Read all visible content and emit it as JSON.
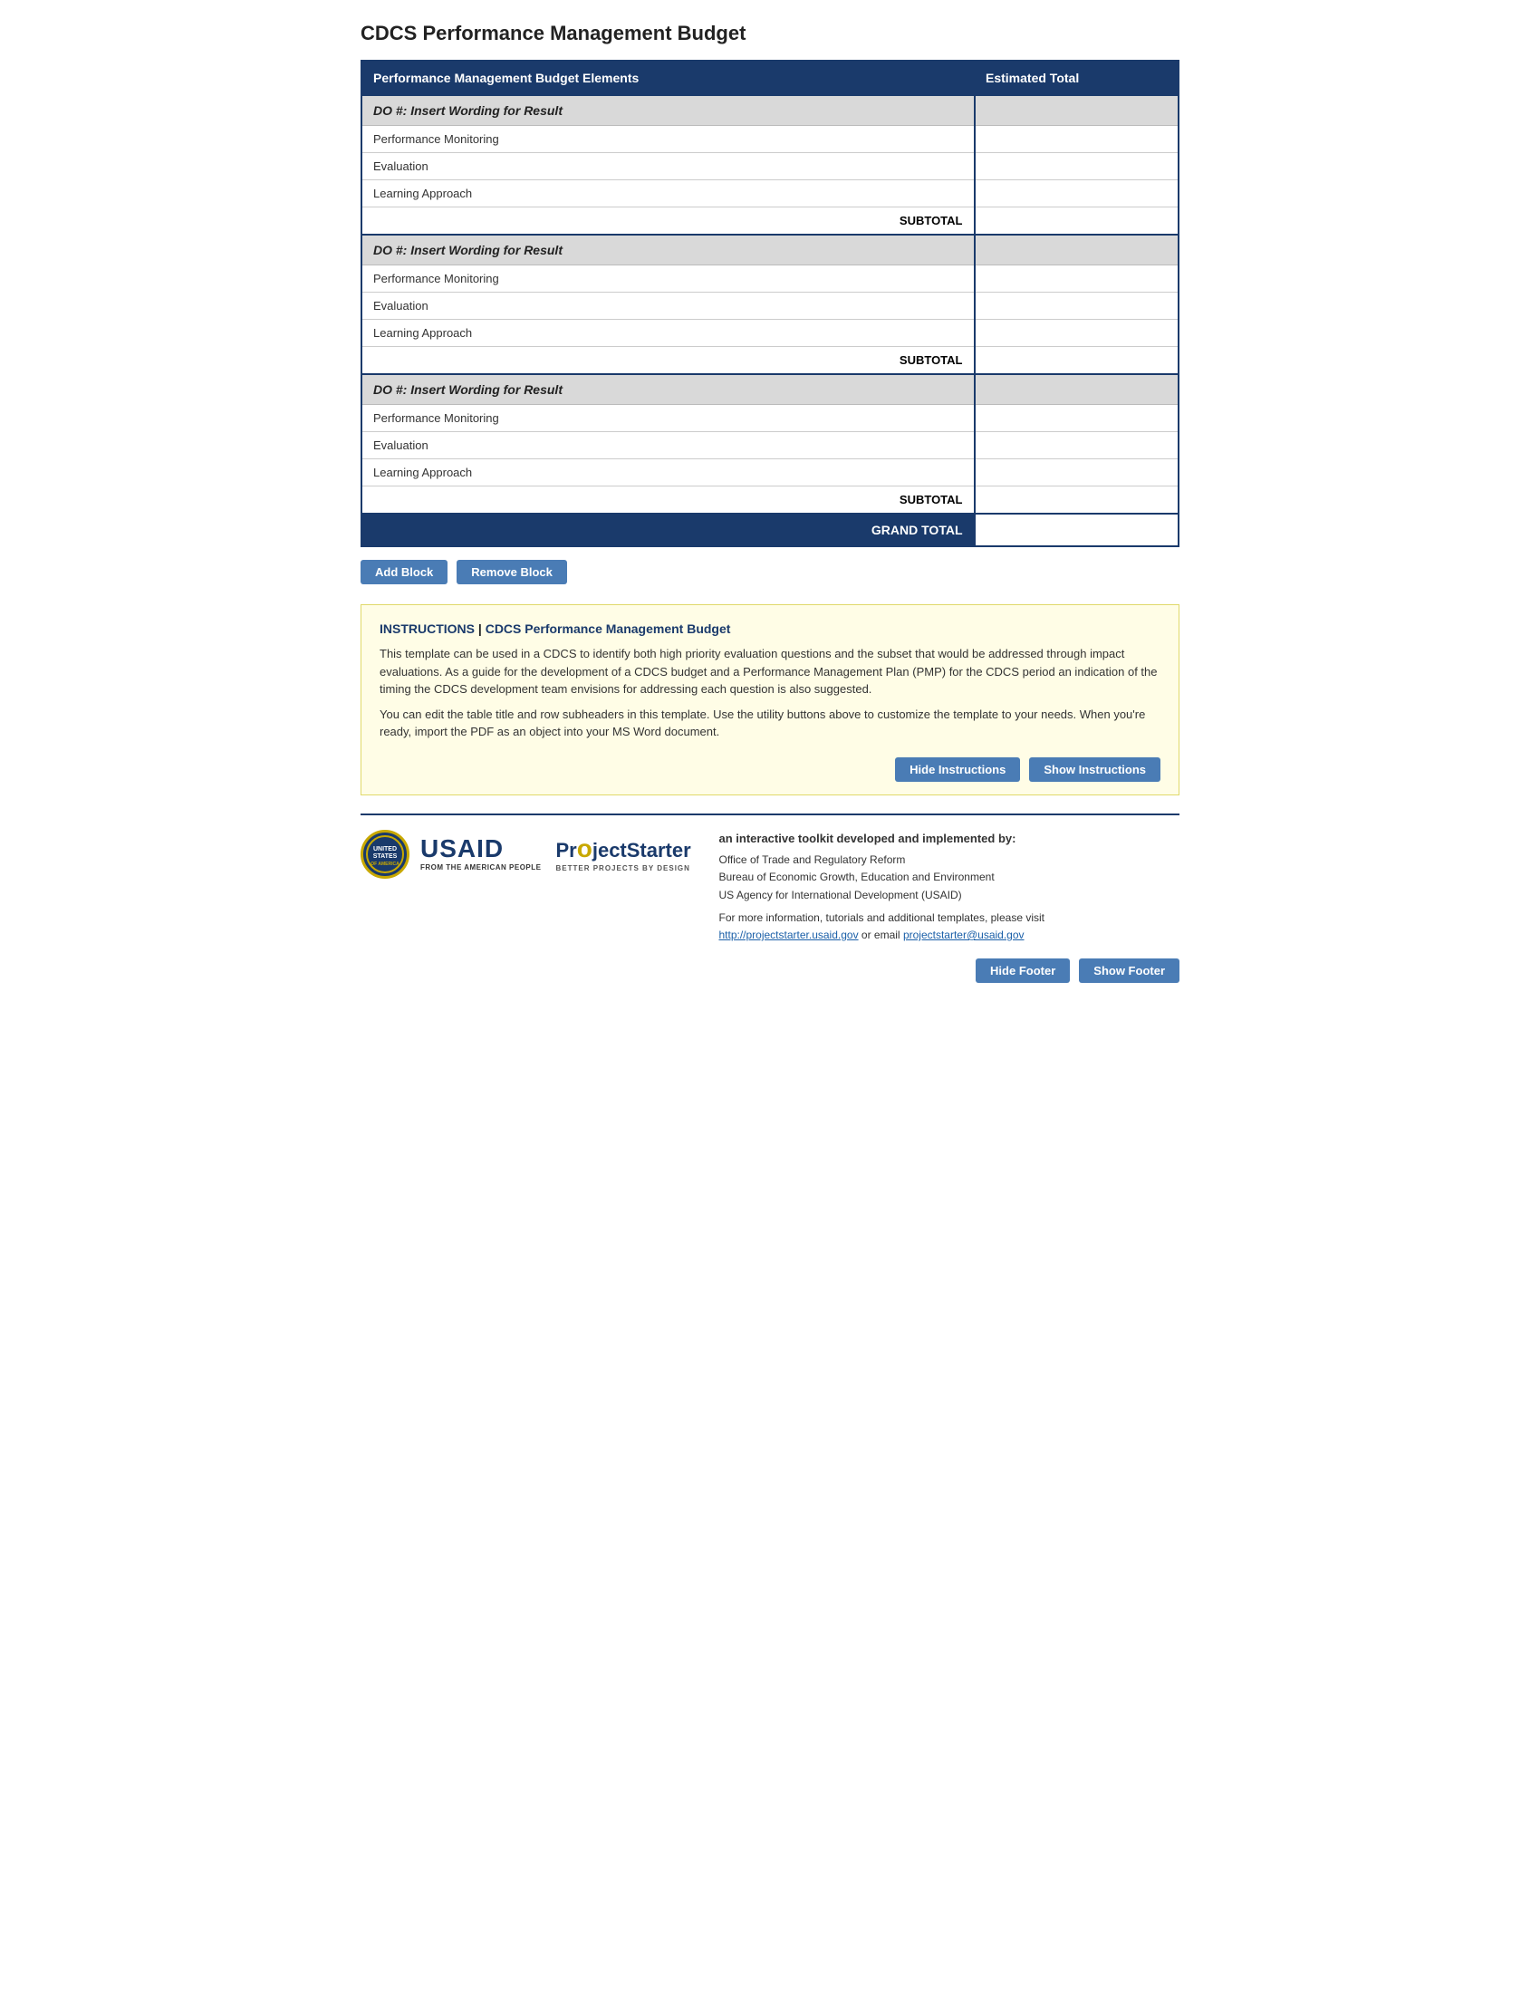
{
  "page": {
    "title": "CDCS Performance Management Budget"
  },
  "table": {
    "col_elements": "Performance Management Budget Elements",
    "col_total": "Estimated Total",
    "blocks": [
      {
        "header": "DO #: Insert Wording for Result",
        "rows": [
          "Performance Monitoring",
          "Evaluation",
          "Learning Approach"
        ],
        "subtotal_label": "SUBTOTAL"
      },
      {
        "header": "DO #: Insert Wording for Result",
        "rows": [
          "Performance Monitoring",
          "Evaluation",
          "Learning Approach"
        ],
        "subtotal_label": "SUBTOTAL"
      },
      {
        "header": "DO #: Insert Wording for Result",
        "rows": [
          "Performance Monitoring",
          "Evaluation",
          "Learning Approach"
        ],
        "subtotal_label": "SUBTOTAL"
      }
    ],
    "grand_total_label": "GRAND TOTAL"
  },
  "buttons": {
    "add_block": "Add Block",
    "remove_block": "Remove Block",
    "hide_instructions": "Hide Instructions",
    "show_instructions": "Show Instructions",
    "hide_footer": "Hide Footer",
    "show_footer": "Show Footer"
  },
  "instructions": {
    "label": "INSTRUCTIONS",
    "separator": " | ",
    "doc_title": "CDCS Performance Management Budget",
    "para1": "This template can be used in a CDCS to identify both high priority evaluation questions and the subset that would be addressed through impact evaluations. As a guide for the development of a CDCS budget and a Performance Management Plan (PMP) for the CDCS period an indication of the timing the CDCS development team envisions for addressing each question is also suggested.",
    "para2": "You can edit the table title and row subheaders in this template. Use the utility buttons above to customize the template to your needs. When you're ready, import the PDF as an object into your MS Word document."
  },
  "footer": {
    "usaid_wordmark": "USAID",
    "usaid_from": "FROM THE AMERICAN PEOPLE",
    "ps_name_part1": "Pr",
    "ps_name_dot": "o",
    "ps_name_part2": "jectStarter",
    "ps_tagline": "BETTER PROJECTS BY DESIGN",
    "developed_by": "an interactive toolkit developed and implemented by:",
    "org1": "Office of Trade and Regulatory Reform",
    "org2": "Bureau of Economic Growth, Education and Environment",
    "org3": "US Agency for International Development (USAID)",
    "more_info": "For more information, tutorials and additional templates, please visit ",
    "link1_text": "http://projectstarter.usaid.gov",
    "link1_href": "http://projectstarter.usaid.gov",
    "or_email": " or email ",
    "link2_text": "projectstarter@usaid.gov",
    "link2_href": "mailto:projectstarter@usaid.gov"
  }
}
